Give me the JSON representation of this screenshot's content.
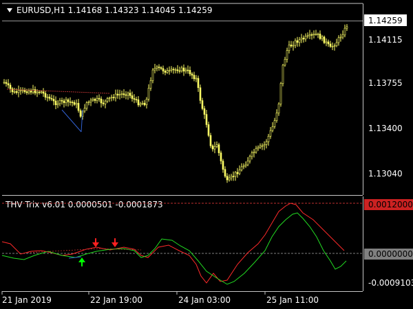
{
  "main_chart": {
    "symbol_header": "EURUSD,H1  1.14168 1.14323 1.14045 1.14259",
    "current_price_label": "1.14259",
    "price_axis": [
      "1.14115",
      "1.13755",
      "1.13400",
      "1.13040"
    ]
  },
  "indicator": {
    "header": "THV Trix v6.01 0.0000501 -0.0001873",
    "axis_labels": [
      "0.0012000",
      "0.0000000",
      "-0.0009103"
    ]
  },
  "time_axis": [
    "21 Jan 2019",
    "22 Jan 19:00",
    "24 Jan 03:00",
    "25 Jan 11:00"
  ],
  "colors": {
    "background": "#000000",
    "grid": "#c8c8c8",
    "candle": "#ffff66",
    "trix_fast": "#ff2a2a",
    "trix_slow": "#22dd22",
    "level_line": "#c03030",
    "signal_up": "#00ff00",
    "signal_down": "#ff2020"
  },
  "icons": {
    "up_arrow": "signal-up-arrow-icon",
    "down_arrow": "signal-down-arrow-icon"
  }
}
